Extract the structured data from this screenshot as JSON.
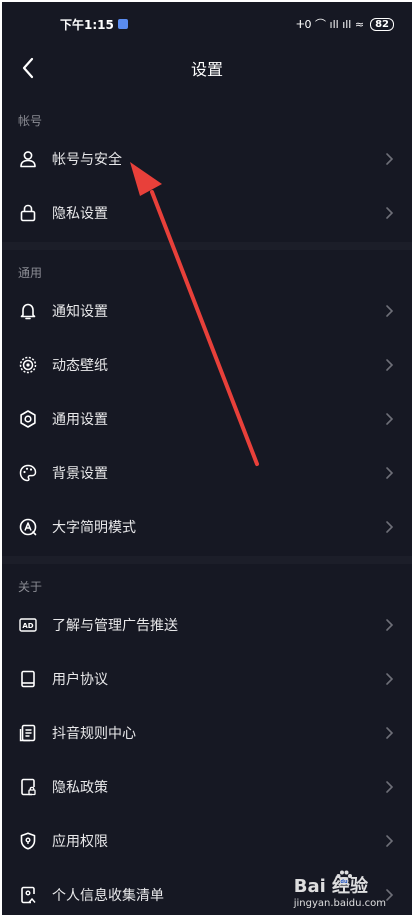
{
  "status": {
    "time": "下午1:15",
    "indicators": "ⵜ0 ⌒ ıll ıll ≈",
    "battery": "82"
  },
  "header": {
    "title": "设置"
  },
  "sections": {
    "account": {
      "label": "帐号",
      "items": [
        {
          "label": "帐号与安全",
          "icon": "user-icon"
        },
        {
          "label": "隐私设置",
          "icon": "lock-icon"
        }
      ]
    },
    "general": {
      "label": "通用",
      "items": [
        {
          "label": "通知设置",
          "icon": "bell-icon"
        },
        {
          "label": "动态壁纸",
          "icon": "wallpaper-icon"
        },
        {
          "label": "通用设置",
          "icon": "gear-icon"
        },
        {
          "label": "背景设置",
          "icon": "palette-icon"
        },
        {
          "label": "大字简明模式",
          "icon": "font-size-icon"
        }
      ]
    },
    "about": {
      "label": "关于",
      "items": [
        {
          "label": "了解与管理广告推送",
          "icon": "ad-icon"
        },
        {
          "label": "用户协议",
          "icon": "book-icon"
        },
        {
          "label": "抖音规则中心",
          "icon": "rules-icon"
        },
        {
          "label": "隐私政策",
          "icon": "privacy-doc-icon"
        },
        {
          "label": "应用权限",
          "icon": "shield-icon"
        },
        {
          "label": "个人信息收集清单",
          "icon": "info-list-icon"
        }
      ]
    }
  },
  "watermark": {
    "brand": "Bai  经验",
    "url": "jingyan.baidu.com"
  },
  "colors": {
    "background": "#161823",
    "text": "#e8e8ea",
    "section_label": "#8a8b93",
    "annotation_arrow": "#e8403a"
  }
}
